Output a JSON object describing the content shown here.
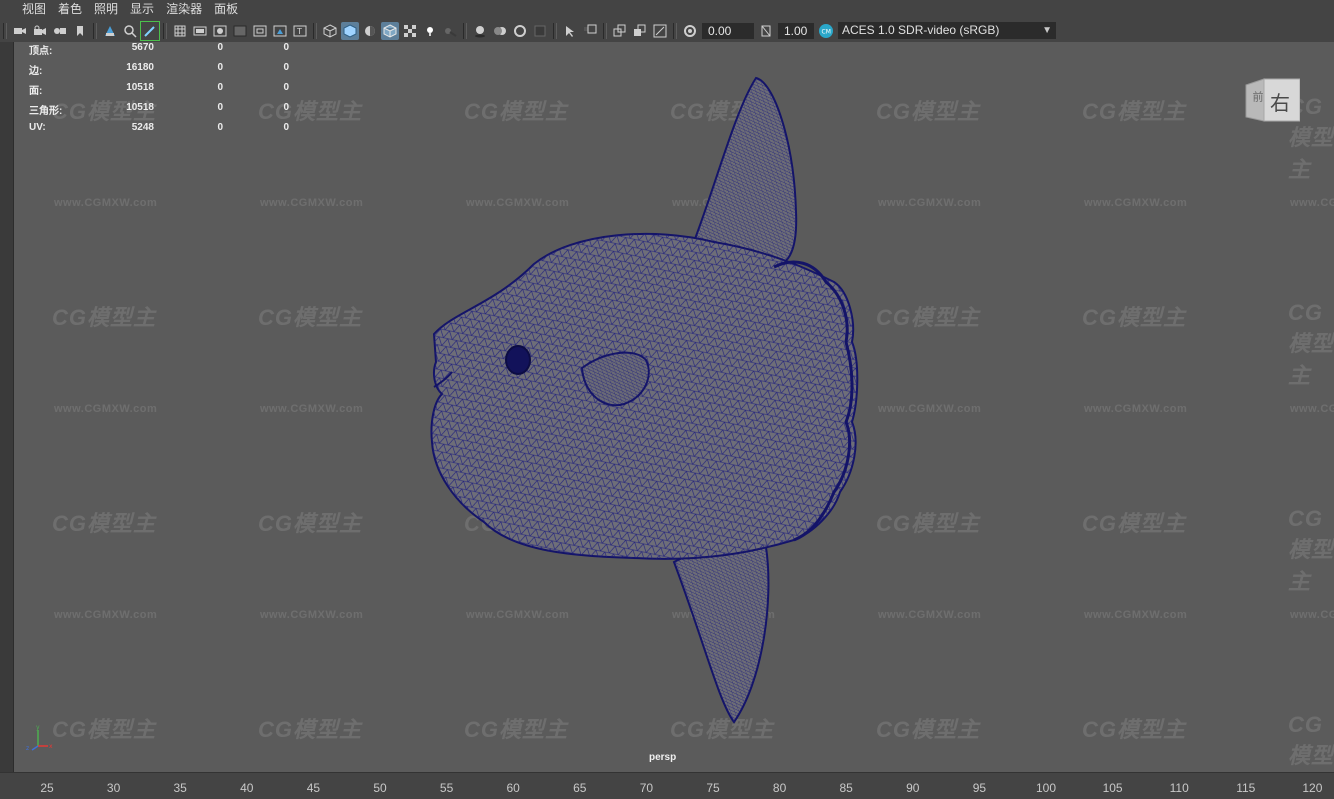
{
  "menu": [
    "视图",
    "着色",
    "照明",
    "显示",
    "渲染器",
    "面板"
  ],
  "toolbar": {
    "exposure_value": "0.00",
    "gamma_value": "1.00",
    "color_space": "ACES 1.0 SDR-video (sRGB)",
    "icons": [
      "camera-select-icon",
      "camera-lock-icon",
      "camera-bookmark-icon",
      "bookmark-icon",
      "image-plane-icon",
      "pan-zoom-icon",
      "grease-pencil-icon",
      "grid-icon",
      "film-gate-icon",
      "resolution-gate-icon",
      "gate-mask-icon",
      "field-chart-icon",
      "safe-action-icon",
      "safe-title-icon",
      "wireframe-icon",
      "smooth-shade-icon",
      "default-material-icon",
      "wireframe-on-shaded-icon",
      "xray-icon",
      "use-all-lights-icon",
      "shadows-icon",
      "screen-space-ao-icon",
      "motion-blur-icon",
      "multisample-aa-icon",
      "depth-of-field-icon",
      "isolate-select-icon",
      "xray-joints-icon",
      "xray-active-components-icon",
      "backface-culling-icon",
      "exposure-icon",
      "gamma-icon",
      "color-management-icon"
    ]
  },
  "hud": {
    "rows": [
      {
        "label": "顶点:",
        "v1": "5670",
        "v2": "0",
        "v3": "0"
      },
      {
        "label": "边:",
        "v1": "16180",
        "v2": "0",
        "v3": "0"
      },
      {
        "label": "面:",
        "v1": "10518",
        "v2": "0",
        "v3": "0"
      },
      {
        "label": "三角形:",
        "v1": "10518",
        "v2": "0",
        "v3": "0"
      },
      {
        "label": "UV:",
        "v1": "5248",
        "v2": "0",
        "v3": "0"
      }
    ]
  },
  "viewport": {
    "camera": "persp",
    "viewcube_label": "右",
    "viewcube_side_label": "前",
    "wireframe_color": "#1a1a7a",
    "background_color": "#5b5b5b"
  },
  "watermark": {
    "logo": "CG模型主",
    "url": "www.CGMXW.com"
  },
  "timeline": {
    "ticks": [
      "25",
      "30",
      "35",
      "40",
      "45",
      "50",
      "55",
      "60",
      "65",
      "70",
      "75",
      "80",
      "85",
      "90",
      "95",
      "100",
      "105",
      "110",
      "115",
      "120"
    ]
  }
}
